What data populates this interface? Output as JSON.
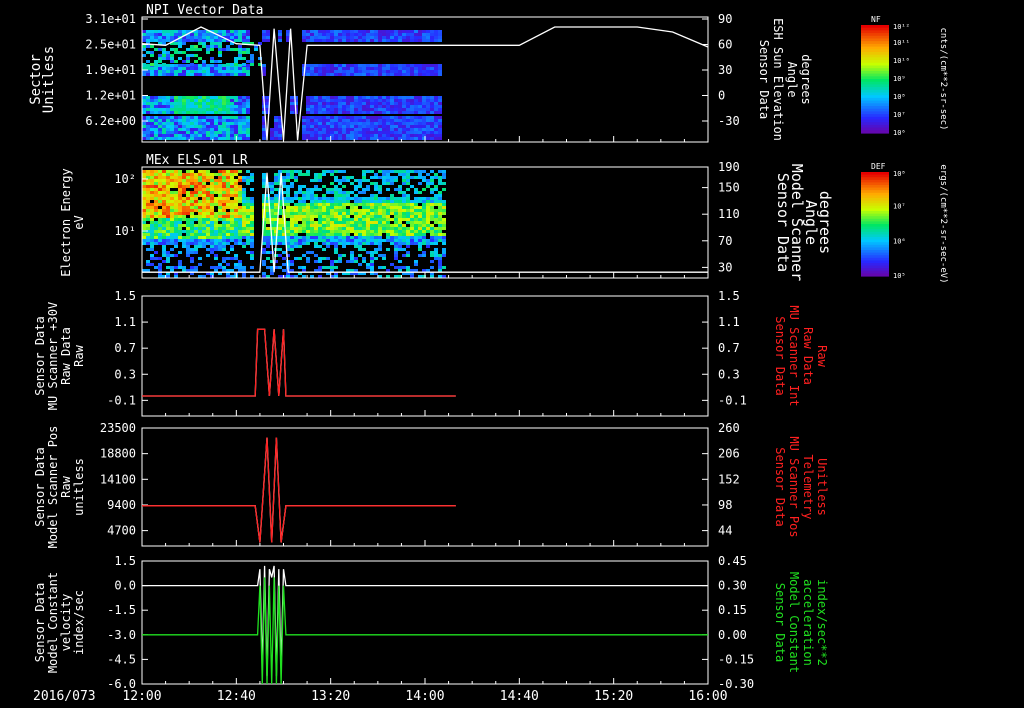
{
  "date_label": "2016/073",
  "time_ticks": [
    "12:00",
    "12:40",
    "13:20",
    "14:00",
    "14:40",
    "15:20",
    "16:00"
  ],
  "colors": {
    "white": "#ffffff",
    "red": "#ff2020",
    "green": "#20e020"
  },
  "chart_data": [
    {
      "id": "p1",
      "type": "heatmap",
      "title": "NPI Vector Data",
      "left_label": [
        "Sector",
        "Unitless"
      ],
      "left_ticks": [
        "3.1e+01",
        "2.5e+01",
        "1.9e+01",
        "1.2e+01",
        "6.2e+00"
      ],
      "right_label": [
        "Sensor Data",
        "ESH Sun Elevation",
        "Angle",
        "degrees"
      ],
      "right_ticks": [
        "90",
        "60",
        "30",
        "0",
        "-30"
      ],
      "right_range": [
        -60,
        90
      ],
      "overlay_series": {
        "name": "ESH Sun Elevation Angle",
        "x": [
          "12:00",
          "12:10",
          "12:25",
          "12:40",
          "12:50",
          "12:53",
          "12:56",
          "13:00",
          "13:03",
          "13:06",
          "13:10",
          "14:40",
          "14:55",
          "15:30",
          "15:45",
          "16:00"
        ],
        "y": [
          58,
          56,
          78,
          58,
          56,
          -58,
          76,
          -58,
          76,
          -58,
          56,
          56,
          78,
          78,
          72,
          54
        ]
      },
      "colorbar": {
        "label": "NF",
        "top": "10¹²",
        "ticks": [
          "10¹¹",
          "10¹⁰",
          "10⁹",
          "10⁸",
          "10⁷",
          "10⁶"
        ],
        "units": "cnts/(cm**2-sr-sec)"
      }
    },
    {
      "id": "p2",
      "type": "heatmap",
      "title": "MEx ELS-01 LR",
      "left_label": [
        "Electron Energy",
        "eV"
      ],
      "left_ticks": [
        "10²",
        "10¹"
      ],
      "right_label": [
        "Sensor Data",
        "Model Scanner",
        "Angle",
        "degrees"
      ],
      "right_ticks": [
        "190",
        "150",
        "110",
        "70",
        "30"
      ],
      "right_range": [
        0,
        190
      ],
      "overlay_series": {
        "name": "Model Scanner Angle",
        "x": [
          "12:00",
          "12:50",
          "12:53",
          "12:56",
          "12:59",
          "13:02",
          "13:05",
          "16:00"
        ],
        "y": [
          10,
          10,
          180,
          10,
          180,
          10,
          10,
          10
        ]
      },
      "colorbar": {
        "label": "DEF",
        "top": "10⁸",
        "ticks": [
          "10⁷",
          "10⁶",
          "10⁵"
        ],
        "units": "ergs/(cm**2-sr-sec-eV)"
      }
    },
    {
      "id": "p3",
      "type": "line",
      "left_label": [
        "Sensor Data",
        "MU Scanner +30V",
        "Raw Data",
        "Raw"
      ],
      "left_ticks": [
        "1.5",
        "1.1",
        "0.7",
        "0.3",
        "-0.1"
      ],
      "right_label": [
        "Sensor Data",
        "MU Scanner Int",
        "Raw Data",
        "Raw"
      ],
      "right_ticks": [
        "1.5",
        "1.1",
        "0.7",
        "0.3",
        "-0.1"
      ],
      "ylim": [
        -0.3,
        1.5
      ],
      "series": [
        {
          "name": "MU Scanner +30V",
          "color": "white",
          "x": [
            "12:00",
            "12:48",
            "12:49",
            "12:52",
            "12:54",
            "12:56",
            "12:58",
            "13:00",
            "13:01",
            "14:13"
          ],
          "y": [
            0,
            0,
            1,
            1,
            0,
            1,
            0,
            1,
            0,
            0
          ]
        },
        {
          "name": "MU Scanner Int",
          "color": "red",
          "x": [
            "12:00",
            "12:48",
            "12:49",
            "12:52",
            "12:54",
            "12:56",
            "12:58",
            "13:00",
            "13:01",
            "14:13"
          ],
          "y": [
            0,
            0,
            1,
            1,
            0,
            1,
            0,
            1,
            0,
            0
          ]
        }
      ]
    },
    {
      "id": "p4",
      "type": "line",
      "left_label": [
        "Sensor Data",
        "Model Scanner Pos",
        "Raw",
        "unitless"
      ],
      "left_ticks": [
        "23500",
        "18800",
        "14100",
        "9400",
        "4700"
      ],
      "right_label": [
        "Sensor Data",
        "MU Scanner Pos",
        "Telemetry",
        "Unitless"
      ],
      "right_ticks": [
        "260",
        "206",
        "152",
        "98",
        "44"
      ],
      "ylim": [
        0,
        23500
      ],
      "series": [
        {
          "name": "Model Scanner Pos",
          "color": "white",
          "x": [
            "12:00",
            "12:48",
            "12:50",
            "12:53",
            "12:55",
            "12:57",
            "12:59",
            "13:01",
            "13:03",
            "14:13"
          ],
          "y": [
            8000,
            8000,
            700,
            21600,
            700,
            21600,
            700,
            8000,
            8000,
            8000
          ]
        },
        {
          "name": "MU Scanner Pos",
          "color": "red",
          "x": [
            "12:00",
            "12:48",
            "12:50",
            "12:53",
            "12:55",
            "12:57",
            "12:59",
            "13:01",
            "13:03",
            "14:13"
          ],
          "y": [
            8000,
            8000,
            700,
            21600,
            700,
            21600,
            700,
            8000,
            8000,
            8000
          ]
        }
      ]
    },
    {
      "id": "p5",
      "type": "line",
      "left_label": [
        "Sensor Data",
        "Model Constant",
        "velocity",
        "index/sec"
      ],
      "left_ticks": [
        "1.5",
        "0.0",
        "-1.5",
        "-3.0",
        "-4.5",
        "-6.0"
      ],
      "right_label": [
        "Sensor Data",
        "Model Constant",
        "acceleration",
        "index/sec**2"
      ],
      "right_ticks": [
        "0.45",
        "0.30",
        "0.15",
        "0.00",
        "-0.15",
        "-0.30"
      ],
      "ylim": [
        -6.0,
        1.5
      ],
      "series": [
        {
          "name": "Model Constant velocity",
          "color": "white",
          "x": [
            "12:00",
            "12:49",
            "12:50",
            "12:51",
            "12:52",
            "12:53",
            "12:54",
            "12:55",
            "12:56",
            "12:57",
            "12:58",
            "12:59",
            "13:00",
            "13:01",
            "16:00"
          ],
          "y": [
            0,
            0,
            1,
            -5,
            1.2,
            -5.5,
            1,
            0.5,
            1.2,
            -5.5,
            1,
            -5,
            1,
            0,
            0
          ]
        },
        {
          "name": "Model Constant acceleration",
          "color": "green",
          "x": [
            "12:00",
            "12:49",
            "12:50",
            "12:51",
            "12:52",
            "12:53",
            "12:54",
            "12:55",
            "12:56",
            "12:57",
            "12:58",
            "12:59",
            "13:00",
            "13:01",
            "16:00"
          ],
          "y": [
            -3,
            -3,
            0,
            -6,
            0.5,
            -6,
            0,
            -6,
            0.5,
            -6,
            0,
            -6,
            0,
            -3,
            -3
          ]
        }
      ]
    }
  ]
}
